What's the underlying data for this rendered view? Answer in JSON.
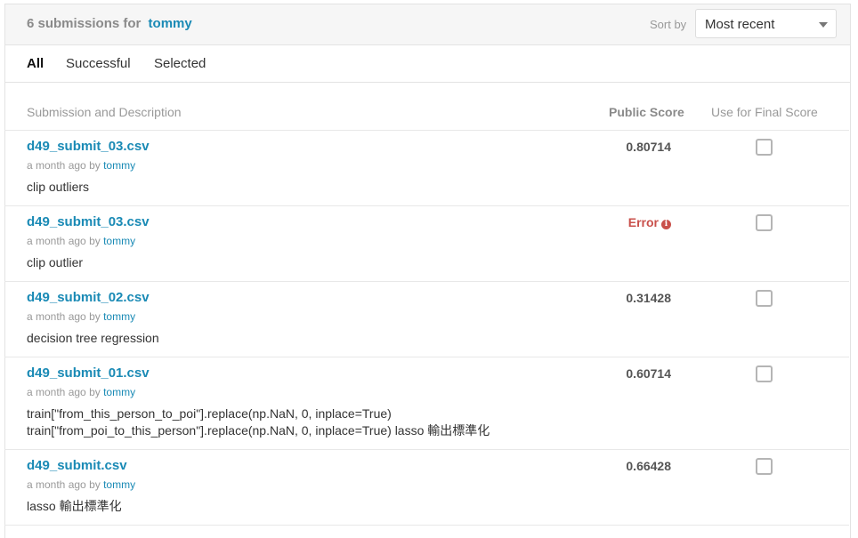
{
  "header": {
    "count_text": "6 submissions for",
    "user": "tommy",
    "sort_label": "Sort by",
    "sort_value": "Most recent"
  },
  "tabs": [
    {
      "label": "All",
      "active": true
    },
    {
      "label": "Successful",
      "active": false
    },
    {
      "label": "Selected",
      "active": false
    }
  ],
  "columns": {
    "submission": "Submission and Description",
    "public_score": "Public Score",
    "final_score": "Use for Final Score"
  },
  "submissions": [
    {
      "name": "d49_submit_03.csv",
      "time": "a month ago",
      "by": "by",
      "user": "tommy",
      "desc1": "clip outliers",
      "desc2": "",
      "score": "0.80714"
    },
    {
      "name": "d49_submit_03.csv",
      "time": "a month ago",
      "by": "by",
      "user": "tommy",
      "desc1": "clip outlier",
      "desc2": "",
      "score": "Error"
    },
    {
      "name": "d49_submit_02.csv",
      "time": "a month ago",
      "by": "by",
      "user": "tommy",
      "desc1": "decision tree regression",
      "desc2": "",
      "score": "0.31428"
    },
    {
      "name": "d49_submit_01.csv",
      "time": "a month ago",
      "by": "by",
      "user": "tommy",
      "desc1": "train[\"from_this_person_to_poi\"].replace(np.NaN, 0, inplace=True)",
      "desc2": "train[\"from_poi_to_this_person\"].replace(np.NaN, 0, inplace=True) lasso 輸出標準化",
      "score": "0.60714"
    },
    {
      "name": "d49_submit.csv",
      "time": "a month ago",
      "by": "by",
      "user": "tommy",
      "desc1": "lasso 輸出標準化",
      "desc2": "",
      "score": "0.66428"
    }
  ],
  "colors": {
    "link": "#1a8ab5",
    "error": "#c9504b",
    "muted": "#999999"
  },
  "icons": {
    "error_info": "info-icon",
    "dropdown": "chevron-down-icon"
  }
}
